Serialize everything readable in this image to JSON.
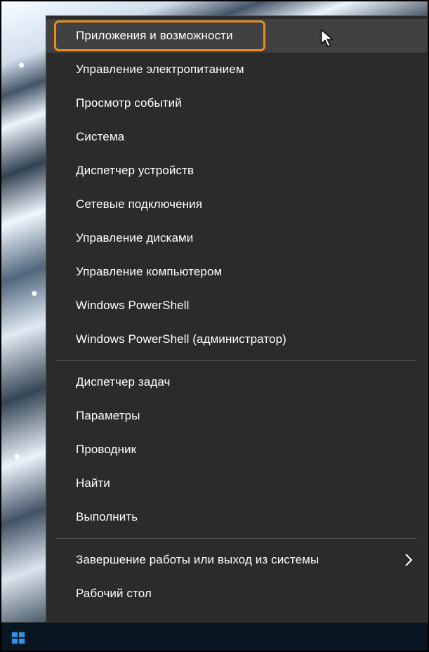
{
  "menu": {
    "groups": [
      {
        "items": [
          {
            "id": "apps-features",
            "label": "Приложения и возможности",
            "highlight": true,
            "hover": true,
            "submenu": false
          },
          {
            "id": "power-management",
            "label": "Управление электропитанием",
            "highlight": false,
            "hover": false,
            "submenu": false
          },
          {
            "id": "event-viewer",
            "label": "Просмотр событий",
            "highlight": false,
            "hover": false,
            "submenu": false
          },
          {
            "id": "system",
            "label": "Система",
            "highlight": false,
            "hover": false,
            "submenu": false
          },
          {
            "id": "device-manager",
            "label": "Диспетчер устройств",
            "highlight": false,
            "hover": false,
            "submenu": false
          },
          {
            "id": "network-connections",
            "label": "Сетевые подключения",
            "highlight": false,
            "hover": false,
            "submenu": false
          },
          {
            "id": "disk-management",
            "label": "Управление дисками",
            "highlight": false,
            "hover": false,
            "submenu": false
          },
          {
            "id": "computer-management",
            "label": "Управление компьютером",
            "highlight": false,
            "hover": false,
            "submenu": false
          },
          {
            "id": "powershell",
            "label": "Windows PowerShell",
            "highlight": false,
            "hover": false,
            "submenu": false
          },
          {
            "id": "powershell-admin",
            "label": "Windows PowerShell (администратор)",
            "highlight": false,
            "hover": false,
            "submenu": false
          }
        ]
      },
      {
        "items": [
          {
            "id": "task-manager",
            "label": "Диспетчер задач",
            "highlight": false,
            "hover": false,
            "submenu": false
          },
          {
            "id": "settings",
            "label": "Параметры",
            "highlight": false,
            "hover": false,
            "submenu": false
          },
          {
            "id": "explorer",
            "label": "Проводник",
            "highlight": false,
            "hover": false,
            "submenu": false
          },
          {
            "id": "search",
            "label": "Найти",
            "highlight": false,
            "hover": false,
            "submenu": false
          },
          {
            "id": "run",
            "label": "Выполнить",
            "highlight": false,
            "hover": false,
            "submenu": false
          }
        ]
      },
      {
        "items": [
          {
            "id": "shutdown-signout",
            "label": "Завершение работы или выход из системы",
            "highlight": false,
            "hover": false,
            "submenu": true
          },
          {
            "id": "desktop",
            "label": "Рабочий стол",
            "highlight": false,
            "hover": false,
            "submenu": false
          }
        ]
      }
    ]
  },
  "colors": {
    "menu_bg": "#2b2b2b",
    "menu_hover": "#414141",
    "highlight_border": "#EC8B21",
    "text": "#ffffff",
    "separator": "#555555",
    "taskbar": "#0a1522",
    "start_logo": "#3390e6"
  }
}
